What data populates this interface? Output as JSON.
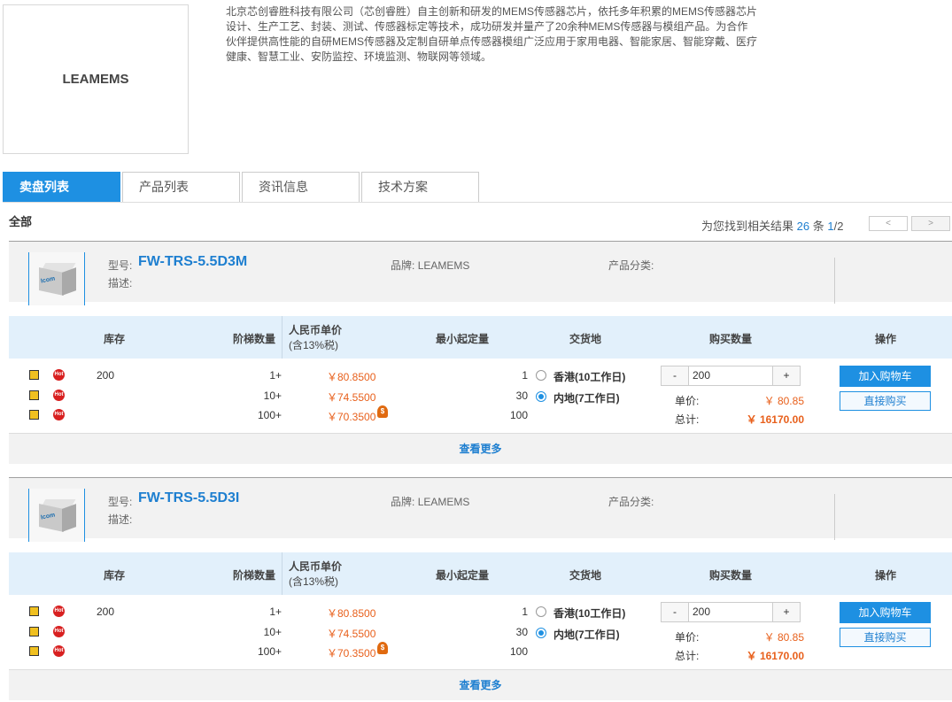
{
  "company": {
    "logo_text": "LEAMEMS",
    "intro": "北京芯创睿胜科技有限公司（芯创睿胜）自主创新和研发的MEMS传感器芯片，依托多年积累的MEMS传感器芯片设计、生产工艺、封装、测试、传感器标定等技术，成功研发并量产了20余种MEMS传感器与模组产品。为合作伙伴提供高性能的自研MEMS传感器及定制自研单点传感器模组广泛应用于家用电器、智能家居、智能穿戴、医疗健康、智慧工业、安防监控、环境监测、物联网等领域。"
  },
  "tabs": [
    {
      "label": "卖盘列表"
    },
    {
      "label": "产品列表"
    },
    {
      "label": "资讯信息"
    },
    {
      "label": "技术方案"
    }
  ],
  "filter": {
    "all_label": "全部"
  },
  "results": {
    "prefix": "为您找到相关结果",
    "count": "26",
    "mid": "条",
    "page": "1",
    "total_pages": "/2",
    "prev": "<",
    "next": ">"
  },
  "labels": {
    "model": "型号:",
    "desc": "描述:",
    "brand": "品牌:",
    "category": "产品分类:",
    "col_stock": "库存",
    "col_tier": "阶梯数量",
    "col_price_1": "人民币单价",
    "col_price_2": "(含13%税)",
    "col_moq": "最小起定量",
    "col_place": "交货地",
    "col_buyqty": "购买数量",
    "col_op": "操作",
    "unit_price": "单价:",
    "total": "总计:",
    "add_cart": "加入购物车",
    "buy_now": "直接购买",
    "more": "查看更多",
    "minus": "-",
    "plus": "+",
    "hot": "Hot",
    "fire": "$"
  },
  "products": [
    {
      "model": "FW-TRS-5.5D3M",
      "brand": "LEAMEMS",
      "stock": "200",
      "tiers": [
        "1+",
        "10+",
        "100+"
      ],
      "prices": [
        "￥80.8500",
        "￥74.5500",
        "￥70.3500"
      ],
      "moq": [
        "1",
        "30",
        "100"
      ],
      "places": [
        "香港(10工作日)",
        "内地(7工作日)"
      ],
      "qty": "200",
      "unit_price": "￥ 80.85",
      "total": "￥ 16170.00",
      "thumb_label": "Icom"
    },
    {
      "model": "FW-TRS-5.5D3I",
      "brand": "LEAMEMS",
      "stock": "200",
      "tiers": [
        "1+",
        "10+",
        "100+"
      ],
      "prices": [
        "￥80.8500",
        "￥74.5500",
        "￥70.3500"
      ],
      "moq": [
        "1",
        "30",
        "100"
      ],
      "places": [
        "香港(10工作日)",
        "内地(7工作日)"
      ],
      "qty": "200",
      "unit_price": "￥ 80.85",
      "total": "￥ 16170.00",
      "thumb_label": "Icom"
    }
  ],
  "colors": {
    "accent": "#1e90e2",
    "price": "#e8601c",
    "header_bg": "#e2f0fb"
  }
}
